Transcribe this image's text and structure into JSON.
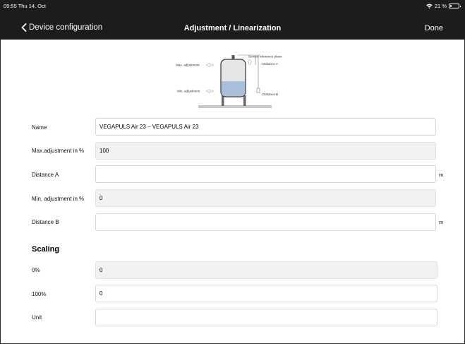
{
  "status_bar": {
    "time": "09:55  Thu 14. Oct",
    "battery": "21 %",
    "battery_level": 0.21
  },
  "nav": {
    "back_label": "Device configuration",
    "title": "Adjustment / Linearization",
    "done_label": "Done"
  },
  "diagram": {
    "sensor_reference_plane": "Sensor reference plane",
    "max_adjustment": "Max. adjustment",
    "min_adjustment": "Min. adjustment",
    "distance_a": "Distance A",
    "distance_b": "Distance B"
  },
  "form": {
    "name": {
      "label": "Name",
      "value": "VEGAPULS Air 23 – VEGAPULS Air 23"
    },
    "max_adjustment": {
      "label": "Max.adjustment in %",
      "value": "100"
    },
    "distance_a": {
      "label": "Distance A",
      "value": "",
      "unit": "m"
    },
    "min_adjustment": {
      "label": "Min. adjustment in %",
      "value": "0"
    },
    "distance_b": {
      "label": "Distance B",
      "value": "",
      "unit": "m"
    }
  },
  "scaling": {
    "heading": "Scaling",
    "zero": {
      "label": "0%",
      "value": "0"
    },
    "hundred": {
      "label": "100%",
      "value": "0"
    },
    "unit": {
      "label": "Unit",
      "value": ""
    }
  }
}
